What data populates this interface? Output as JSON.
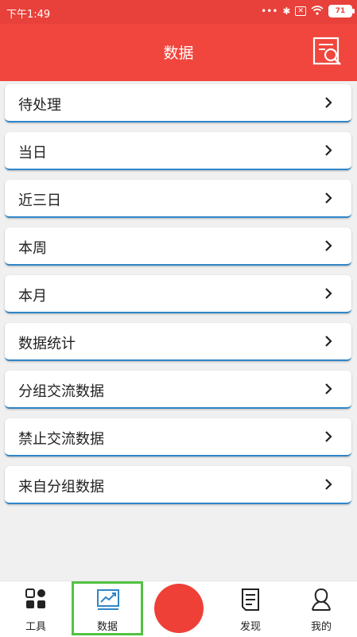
{
  "status_bar": {
    "time": "下午1:49",
    "battery": "71"
  },
  "header": {
    "title": "数据",
    "search_icon": "document-search-icon"
  },
  "menu": [
    {
      "label": "待处理"
    },
    {
      "label": "当日"
    },
    {
      "label": "近三日"
    },
    {
      "label": "本周"
    },
    {
      "label": "本月"
    },
    {
      "label": "数据统计"
    },
    {
      "label": "分组交流数据"
    },
    {
      "label": "禁止交流数据"
    },
    {
      "label": "来自分组数据"
    }
  ],
  "tabs": [
    {
      "label": "工具",
      "icon": "grid-icon"
    },
    {
      "label": "数据",
      "icon": "chart-icon",
      "active": true
    },
    {
      "label": "发现",
      "icon": "document-icon"
    },
    {
      "label": "我的",
      "icon": "user-icon"
    }
  ],
  "colors": {
    "primary": "#f0463e",
    "accent_border": "#2f86c9",
    "active_tab": "#52c242"
  }
}
